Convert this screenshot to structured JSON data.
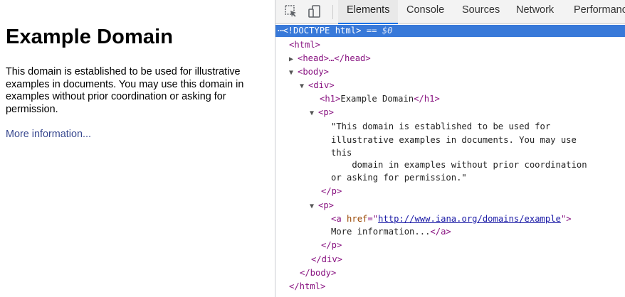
{
  "page": {
    "heading": "Example Domain",
    "paragraph": "This domain is established to be used for illustrative examples in documents. You may use this domain in examples without prior coordination or asking for permission.",
    "link_text": "More information..."
  },
  "devtools": {
    "tabs": [
      "Elements",
      "Console",
      "Sources",
      "Network",
      "Performanc"
    ],
    "active_tab": "Elements",
    "icons": [
      "inspect-element-icon",
      "device-toolbar-icon"
    ],
    "tree": {
      "doctype": "<!DOCTYPE html>",
      "selected_marker": "== $0",
      "html_open": "<html>",
      "head_collapsed": "<head>…</head>",
      "body_open": "<body>",
      "div_open": "<div>",
      "h1_open": "<h1>",
      "h1_text": "Example Domain",
      "h1_close": "</h1>",
      "p_open": "<p>",
      "p1_text_line1": "\"This domain is established to be used for",
      "p1_text_line2": "illustrative examples in documents. You may use",
      "p1_text_line3": "this",
      "p1_text_line4": "    domain in examples without prior coordination",
      "p1_text_line5": "or asking for permission.\"",
      "p_close": "</p>",
      "a_tag_open": "<a",
      "a_attr_name": "href",
      "a_href": "http://www.iana.org/domains/example",
      "a_text": "More information...",
      "a_close": "</a>",
      "div_close": "</div>",
      "body_close": "</body>",
      "html_close": "</html>"
    }
  },
  "colors": {
    "selection": "#3879d9",
    "tag": "#881280",
    "attr": "#994500",
    "value": "#1a1aa6",
    "page_link": "#38488f"
  }
}
